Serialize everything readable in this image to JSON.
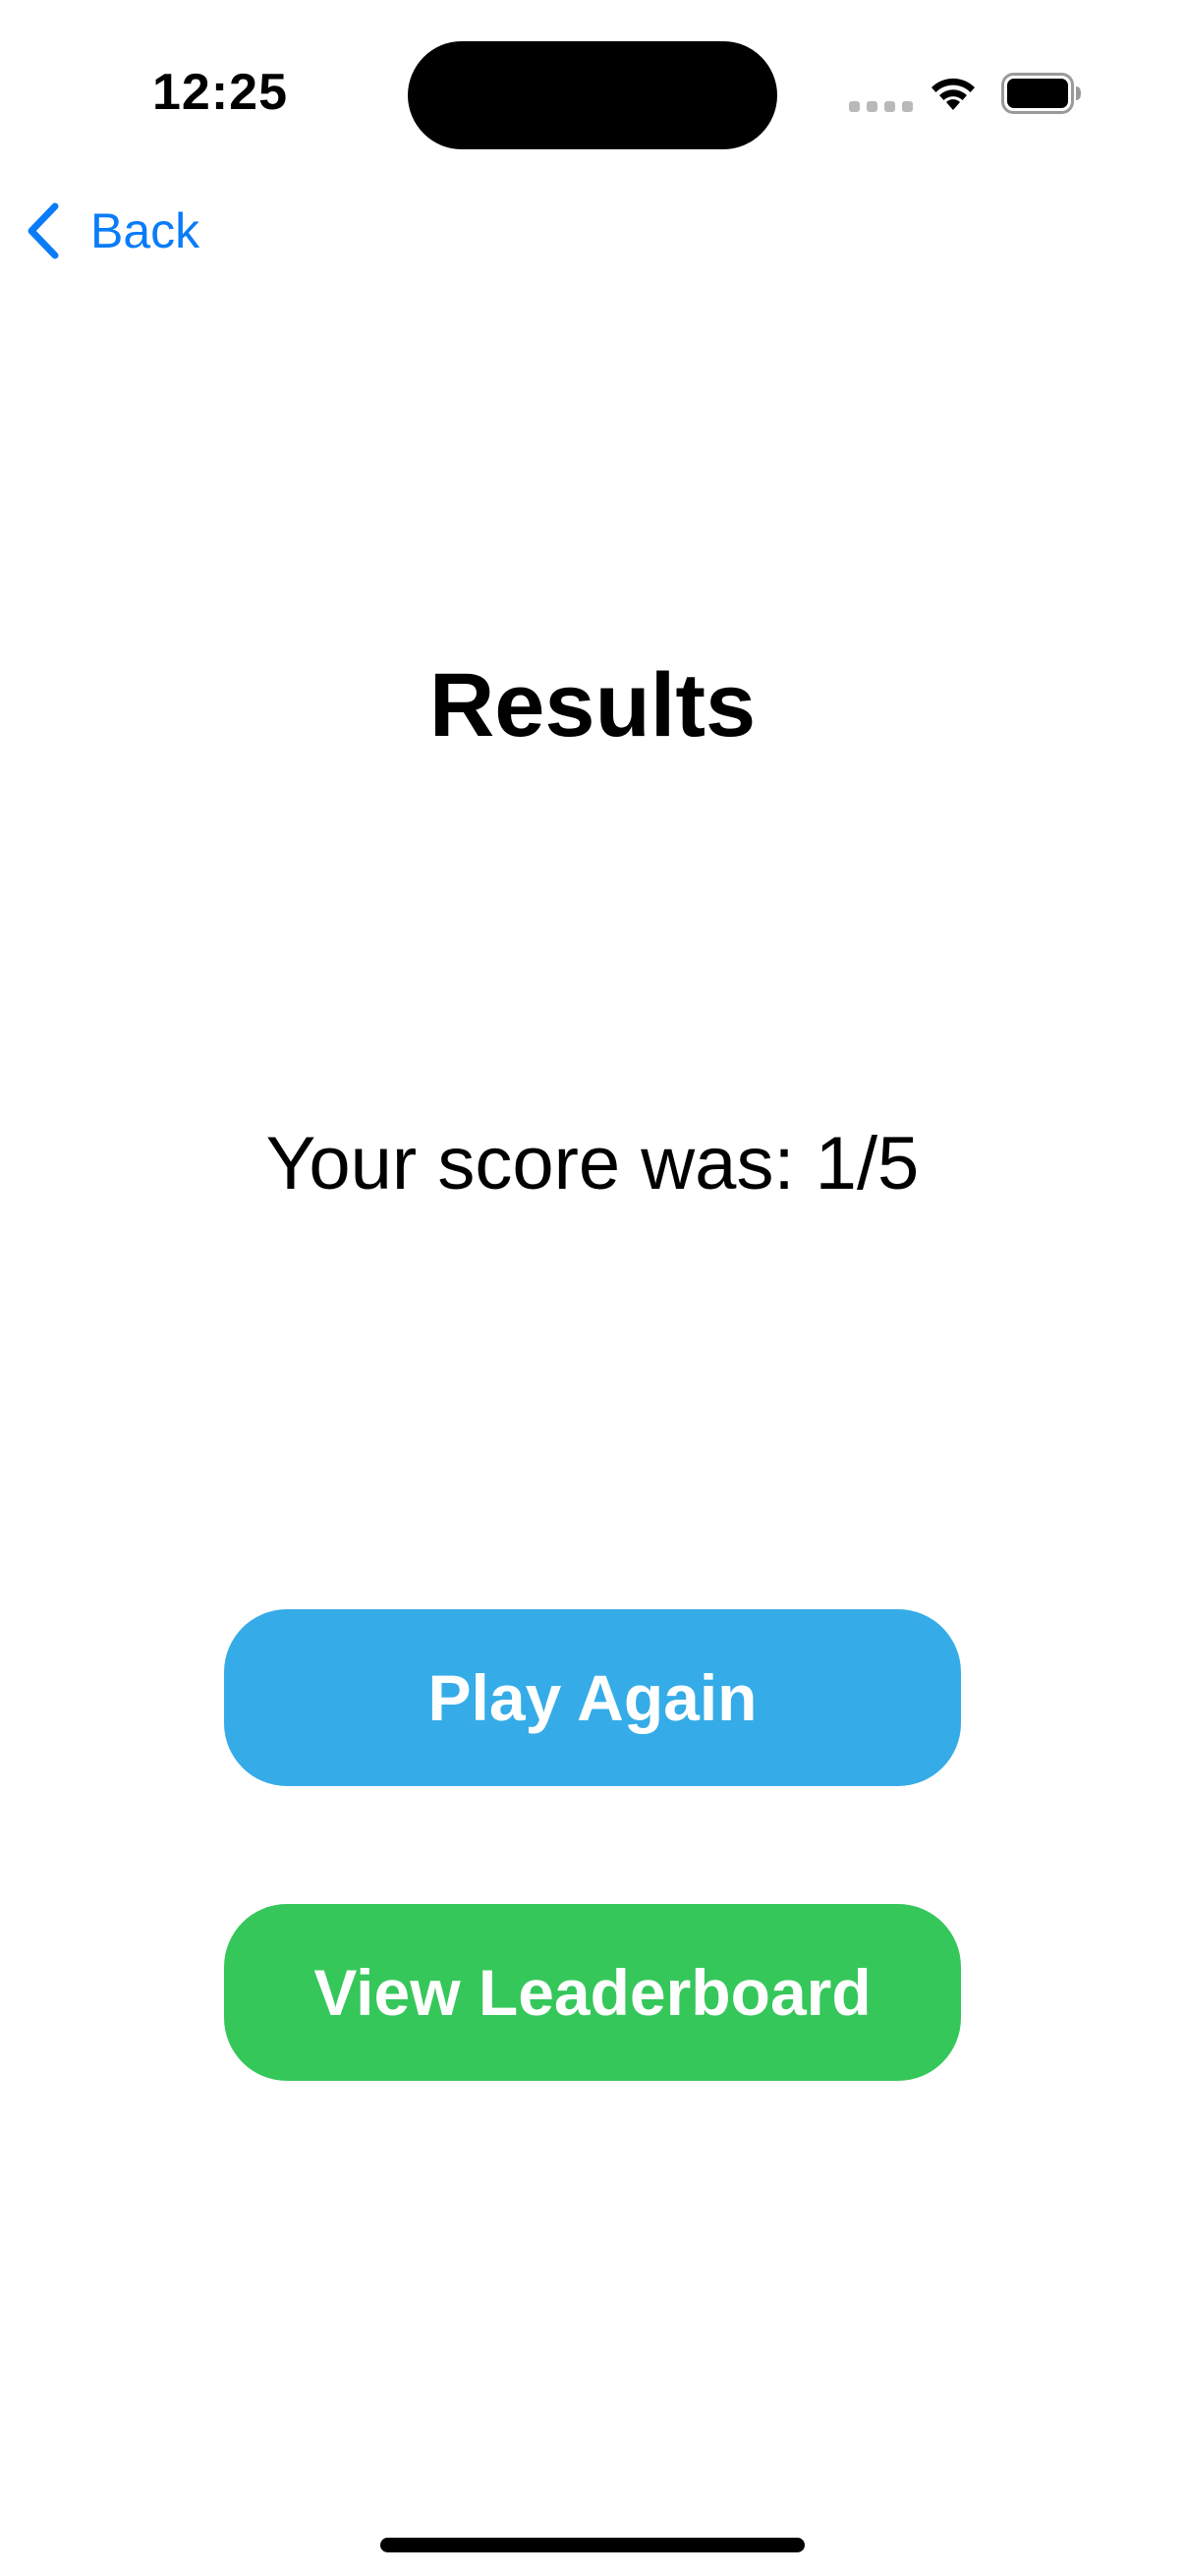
{
  "status_bar": {
    "time": "12:25"
  },
  "navigation": {
    "back_label": "Back"
  },
  "main": {
    "title": "Results",
    "score_text": "Your score was: 1/5"
  },
  "buttons": {
    "play_again": "Play Again",
    "view_leaderboard": "View Leaderboard"
  },
  "colors": {
    "accent_blue": "#0a7cf7",
    "play_again_bg": "#35ace7",
    "leaderboard_bg": "#36c75b"
  },
  "icons": {
    "back": "chevron-left-icon",
    "wifi": "wifi-icon",
    "battery": "battery-icon",
    "signal": "cellular-signal-icon"
  }
}
